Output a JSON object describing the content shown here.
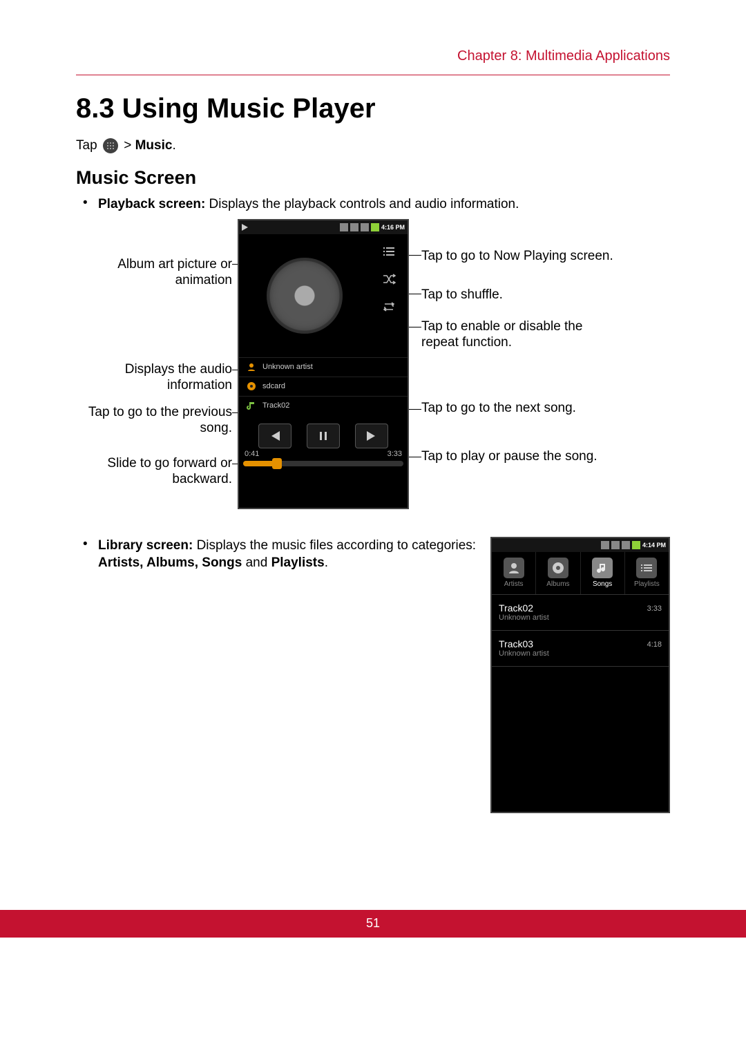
{
  "header": {
    "chapter": "Chapter 8: Multimedia Applications"
  },
  "section": {
    "title": "8.3 Using Music Player"
  },
  "tapline": {
    "tap": "Tap ",
    "arrow": " > ",
    "music": "Music",
    "period": "."
  },
  "subheading": "Music Screen",
  "bullet1": {
    "lead": "Playback screen: ",
    "rest": "Displays the playback controls and audio information."
  },
  "phone1": {
    "statusTime": "4:16 PM",
    "info": {
      "artist": "Unknown artist",
      "album": "sdcard",
      "track": "Track02"
    },
    "time": {
      "elapsed": "0:41",
      "total": "3:33"
    }
  },
  "callouts": {
    "l1": "Album art picture or animation",
    "l2": "Displays the audio information",
    "l3": "Tap to go to the previous song.",
    "l4": "Slide to go forward or backward.",
    "r1": "Tap to go to Now Playing screen.",
    "r2": "Tap to shuffle.",
    "r3": "Tap to enable or disable the repeat function.",
    "r4": "Tap to go to the next song.",
    "r5": "Tap to play or pause the song."
  },
  "bullet2": {
    "lead": "Library screen: ",
    "rest1": "Displays the music files according to categories: ",
    "bold1": "Artists, Albums, Songs",
    "rest2": " and ",
    "bold2": "Playlists",
    "period": "."
  },
  "phone2": {
    "statusTime": "4:14 PM",
    "tabs": {
      "artists": "Artists",
      "albums": "Albums",
      "songs": "Songs",
      "playlists": "Playlists"
    },
    "rows": [
      {
        "title": "Track02",
        "artist": "Unknown artist",
        "dur": "3:33"
      },
      {
        "title": "Track03",
        "artist": "Unknown artist",
        "dur": "4:18"
      }
    ]
  },
  "footer": {
    "page": "51"
  }
}
